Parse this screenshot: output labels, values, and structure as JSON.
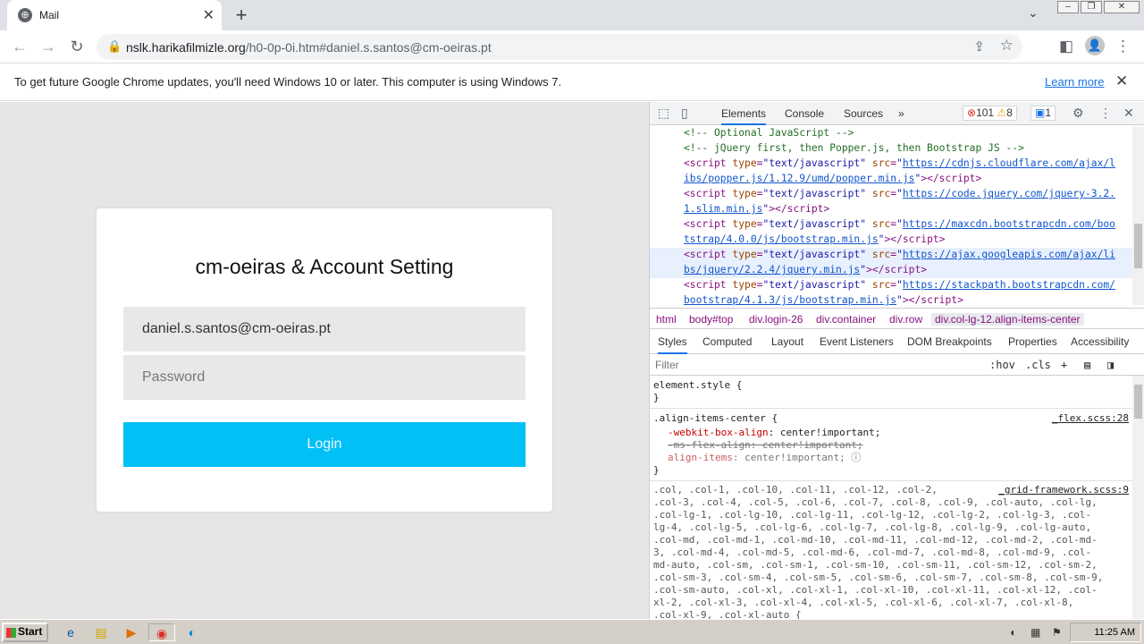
{
  "browser": {
    "tab_title": "Mail",
    "new_tab": "+",
    "url_domain": "nslk.harikafilmizle.org",
    "url_path": "/h0-0p-0i.htm#daniel.s.santos@cm-oeiras.pt"
  },
  "infobar": {
    "message": "To get future Google Chrome updates, you'll need Windows 10 or later. This computer is using Windows 7.",
    "learn_more": "Learn more"
  },
  "login": {
    "heading": "cm-oeiras & Account Setting",
    "email_value": "daniel.s.santos@cm-oeiras.pt",
    "password_placeholder": "Password",
    "button": "Login",
    "button_color": "#00c0f6"
  },
  "devtools": {
    "tabs": [
      "Elements",
      "Console",
      "Sources",
      "»"
    ],
    "errors": "101",
    "warnings": "8",
    "messages": "1",
    "code": {
      "c1": "<!-- Optional JavaScript -->",
      "c2": "<!-- jQuery first, then Popper.js, then Bootstrap JS -->",
      "s1a": "https://cdnjs.cloudflare.com/ajax/l",
      "s1b": "ibs/popper.js/1.12.9/umd/popper.min.js",
      "s2a": "https://code.jquery.com/jquery-3.2.",
      "s2b": "1.slim.min.js",
      "s3a": "https://maxcdn.bootstrapcdn.com/boo",
      "s3b": "tstrap/4.0.0/js/bootstrap.min.js",
      "s4a": "https://ajax.googleapis.com/ajax/li",
      "s4b": "bs/jquery/2.2.4/jquery.min.js",
      "s5a": "https://stackpath.bootstrapcdn.com/",
      "s5b": "bootstrap/4.1.3/js/bootstrap.min.js"
    },
    "breadcrumbs": [
      "html",
      "body#top",
      "div.login-26",
      "div.container",
      "div.row",
      "div.col-lg-12.align-items-center"
    ],
    "style_tabs": [
      "Styles",
      "Computed",
      "Layout",
      "Event Listeners",
      "DOM Breakpoints",
      "Properties",
      "Accessibility"
    ],
    "filter_placeholder": "Filter",
    "hov": ":hov",
    "cls": ".cls",
    "styles": {
      "element_style": "element.style {",
      "close": "}",
      "rule1_selector": ".align-items-center {",
      "rule1_source": "_flex.scss:28",
      "rule1_p1": "-webkit-box-align",
      "rule1_v1": "center!important;",
      "rule1_p2": "-ms-flex-align: center!important;",
      "rule1_p3": "align-items",
      "rule1_v3": "center!important;",
      "rule2_source": "_grid-framework.scss:9",
      "rule2_lines": [
        ".col, .col-1, .col-10, .col-11, .col-12, .col-2,",
        ".col-3, .col-4, .col-5, .col-6, .col-7, .col-8, .col-9, .col-auto, .col-lg,",
        ".col-lg-1, .col-lg-10, .col-lg-11, .col-lg-12, .col-lg-2, .col-lg-3, .col-",
        "lg-4, .col-lg-5, .col-lg-6, .col-lg-7, .col-lg-8, .col-lg-9, .col-lg-auto,",
        ".col-md, .col-md-1, .col-md-10, .col-md-11, .col-md-12, .col-md-2, .col-md-",
        "3, .col-md-4, .col-md-5, .col-md-6, .col-md-7, .col-md-8, .col-md-9, .col-",
        "md-auto, .col-sm, .col-sm-1, .col-sm-10, .col-sm-11, .col-sm-12, .col-sm-2,",
        ".col-sm-3, .col-sm-4, .col-sm-5, .col-sm-6, .col-sm-7, .col-sm-8, .col-sm-9,",
        ".col-sm-auto, .col-xl, .col-xl-1, .col-xl-10, .col-xl-11, .col-xl-12, .col-",
        "xl-2, .col-xl-3, .col-xl-4, .col-xl-5, .col-xl-6, .col-xl-7, .col-xl-8,",
        ".col-xl-9, .col-xl-auto {"
      ]
    }
  },
  "taskbar": {
    "start": "Start",
    "clock": "11:25 AM"
  }
}
